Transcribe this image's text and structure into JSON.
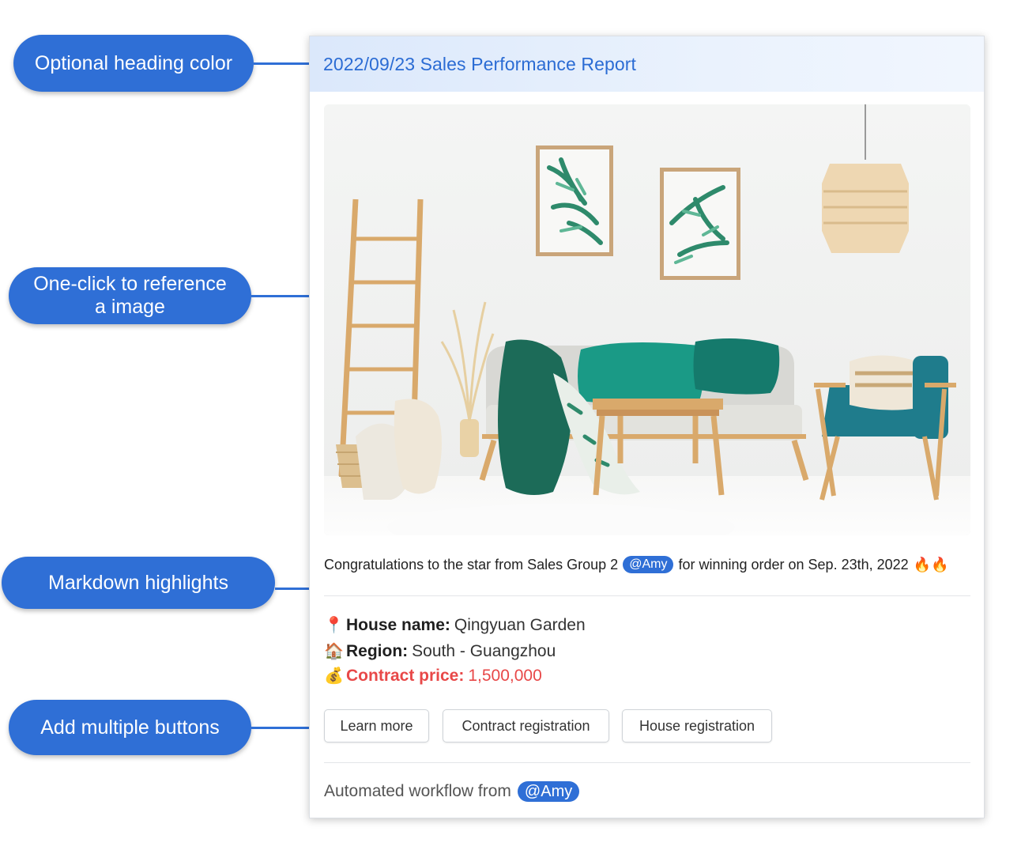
{
  "callouts": {
    "heading_color": "Optional heading color",
    "reference_image_line1": "One-click to reference",
    "reference_image_line2": "a image",
    "markdown": "Markdown highlights",
    "buttons": "Add multiple buttons"
  },
  "card": {
    "title": "2022/09/23 Sales Performance Report",
    "hero_icon": "living-room-photo",
    "congrats": {
      "prefix": "Congratulations to the star from Sales Group 2",
      "mention": "@Amy",
      "suffix": "for winning order on Sep. 23th, 2022",
      "emoji": "🔥🔥"
    },
    "details": [
      {
        "emoji": "📍",
        "key": "House name:",
        "value": "Qingyuan Garden"
      },
      {
        "emoji": "🏠",
        "key": "Region:",
        "value": "South - Guangzhou"
      },
      {
        "emoji": "💰",
        "key": "Contract price:",
        "value": "1,500,000"
      }
    ],
    "buttons": [
      "Learn more",
      "Contract registration",
      "House registration"
    ],
    "footer": {
      "text": "Automated workflow from",
      "mention": "@Amy"
    }
  },
  "colors": {
    "accent": "#2f6fd6",
    "title": "#2b6cd4",
    "highlight_red": "#e84848"
  }
}
